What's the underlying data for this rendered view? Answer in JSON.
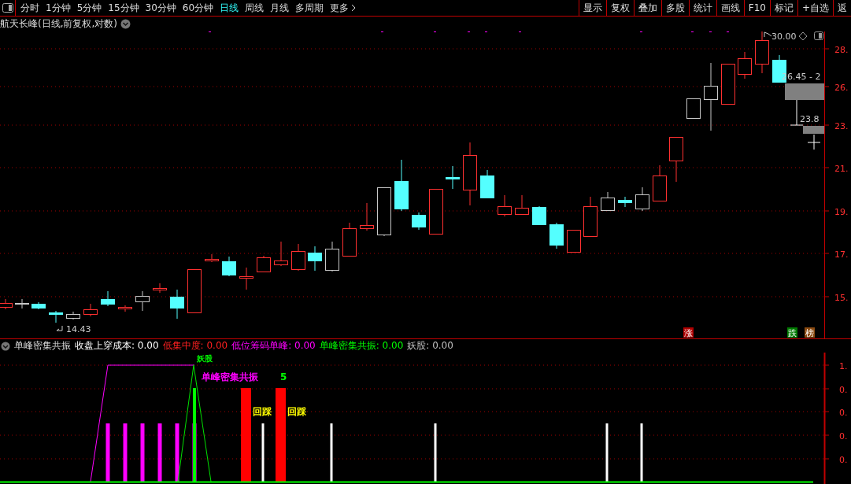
{
  "toolbar": {
    "periods": [
      {
        "label": "分时",
        "selected": false
      },
      {
        "label": "1分钟",
        "selected": false
      },
      {
        "label": "5分钟",
        "selected": false
      },
      {
        "label": "15分钟",
        "selected": false
      },
      {
        "label": "30分钟",
        "selected": false
      },
      {
        "label": "60分钟",
        "selected": false
      },
      {
        "label": "日线",
        "selected": true
      },
      {
        "label": "周线",
        "selected": false
      },
      {
        "label": "月线",
        "selected": false
      },
      {
        "label": "多周期",
        "selected": false
      }
    ],
    "more": "更多",
    "buttons": [
      "显示",
      "复权",
      "叠加",
      "多股",
      "统计",
      "画线",
      "F10",
      "标记",
      "+自选",
      "返"
    ]
  },
  "title": "航天长峰(日线,前复权,对数)",
  "main_chart": {
    "price_labels": [
      "30.00",
      "14.43",
      "26.45 - 2",
      "23.8"
    ],
    "y_axis": [
      "28.",
      "26.",
      "23.",
      "21.",
      "19.",
      "17.",
      "15."
    ],
    "badges": [
      {
        "text": "涨",
        "color": "#b00000"
      },
      {
        "text": "跌",
        "color": "#007a00"
      },
      {
        "text": "榜",
        "color": "#8b4a10"
      }
    ]
  },
  "indicator": {
    "name": "单峰密集共振",
    "values": [
      {
        "label": "收盘上穿成本: 0.00",
        "color": "#ffffff"
      },
      {
        "label": "低集中度: 0.00",
        "color": "#ff2020"
      },
      {
        "label": "低位筹码单峰: 0.00",
        "color": "#ff00ff"
      },
      {
        "label": "单峰密集共振: 0.00",
        "color": "#00ff00"
      },
      {
        "label": "妖股: 0.00",
        "color": "#c0c0c0"
      }
    ],
    "annotations": [
      {
        "text": "妖股",
        "color": "#00ff00"
      },
      {
        "text": "单峰密集共振",
        "color": "#ff00ff"
      },
      {
        "text": "5",
        "color": "#00ff00"
      },
      {
        "text": "回踩",
        "color": "#ffff00"
      },
      {
        "text": "回踩",
        "color": "#ffff00"
      }
    ],
    "y_axis": [
      "1.",
      "0.",
      "0.",
      "0.",
      "0."
    ]
  }
}
